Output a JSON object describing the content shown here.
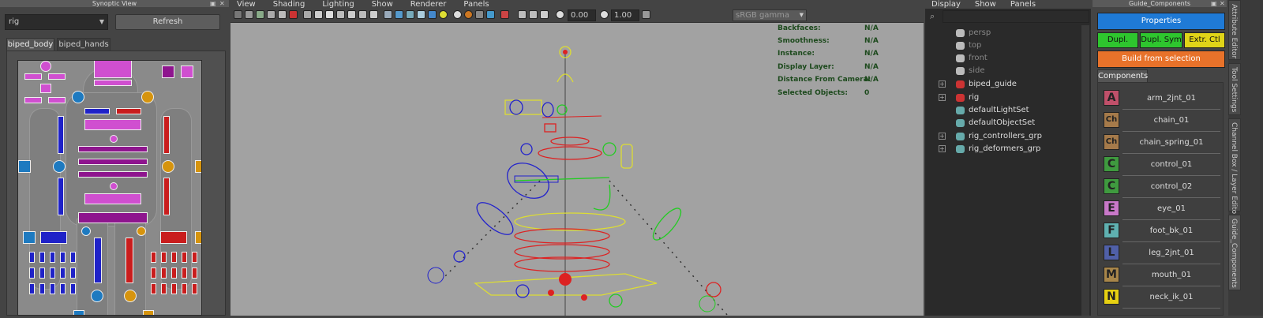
{
  "synoptic": {
    "title": "Synoptic View",
    "rig_select": "rig",
    "refresh_label": "Refresh",
    "tabs": [
      "biped_body",
      "biped_hands"
    ]
  },
  "viewport": {
    "menu": [
      "View",
      "Shading",
      "Lighting",
      "Show",
      "Renderer",
      "Panels"
    ],
    "exposure": "0.00",
    "gamma": "1.00",
    "color_space": "sRGB gamma",
    "hud": [
      {
        "label": "Backfaces:",
        "value": "N/A"
      },
      {
        "label": "Smoothness:",
        "value": "N/A"
      },
      {
        "label": "Instance:",
        "value": "N/A"
      },
      {
        "label": "Display Layer:",
        "value": "N/A"
      },
      {
        "label": "Distance From Camera:",
        "value": "N/A"
      },
      {
        "label": "Selected Objects:",
        "value": "0"
      }
    ]
  },
  "outliner": {
    "menu": [
      "Display",
      "Show",
      "Panels"
    ],
    "items": [
      {
        "label": "persp",
        "dim": true,
        "expandable": false,
        "icon": "camera-icon"
      },
      {
        "label": "top",
        "dim": true,
        "expandable": false,
        "icon": "camera-icon"
      },
      {
        "label": "front",
        "dim": true,
        "expandable": false,
        "icon": "camera-icon"
      },
      {
        "label": "side",
        "dim": true,
        "expandable": false,
        "icon": "camera-icon"
      },
      {
        "label": "biped_guide",
        "dim": false,
        "expandable": true,
        "icon": "transform-icon"
      },
      {
        "label": "rig",
        "dim": false,
        "expandable": true,
        "icon": "transform-icon"
      },
      {
        "label": "defaultLightSet",
        "dim": false,
        "expandable": false,
        "icon": "set-icon"
      },
      {
        "label": "defaultObjectSet",
        "dim": false,
        "expandable": false,
        "icon": "set-icon"
      },
      {
        "label": "rig_controllers_grp",
        "dim": false,
        "expandable": true,
        "icon": "set-icon"
      },
      {
        "label": "rig_deformers_grp",
        "dim": false,
        "expandable": true,
        "icon": "set-icon"
      }
    ]
  },
  "guide": {
    "title": "Guide_Components",
    "properties_label": "Properties",
    "dupl_label": "Dupl.",
    "dupl_sym_label": "Dupl. Sym",
    "extr_ctl_label": "Extr. Ctl",
    "build_label": "Build from selection",
    "components_tab": "Components",
    "components": [
      {
        "letter": "A",
        "label": "arm_2jnt_01",
        "color": "#c0506a"
      },
      {
        "letter": "Ch",
        "label": "chain_01",
        "color": "#a57a4a"
      },
      {
        "letter": "Ch",
        "label": "chain_spring_01",
        "color": "#a57a4a"
      },
      {
        "letter": "C",
        "label": "control_01",
        "color": "#3f9a3f"
      },
      {
        "letter": "C",
        "label": "control_02",
        "color": "#3f9a3f"
      },
      {
        "letter": "E",
        "label": "eye_01",
        "color": "#c878c8"
      },
      {
        "letter": "F",
        "label": "foot_bk_01",
        "color": "#5fb0b0"
      },
      {
        "letter": "L",
        "label": "leg_2jnt_01",
        "color": "#5060a8"
      },
      {
        "letter": "M",
        "label": "mouth_01",
        "color": "#a8864a"
      },
      {
        "letter": "N",
        "label": "neck_ik_01",
        "color": "#e6d012"
      }
    ]
  },
  "side_tabs": [
    "Attribute Editor",
    "Tool Settings",
    "Channel Box / Layer Editor",
    "Guide_Components"
  ]
}
